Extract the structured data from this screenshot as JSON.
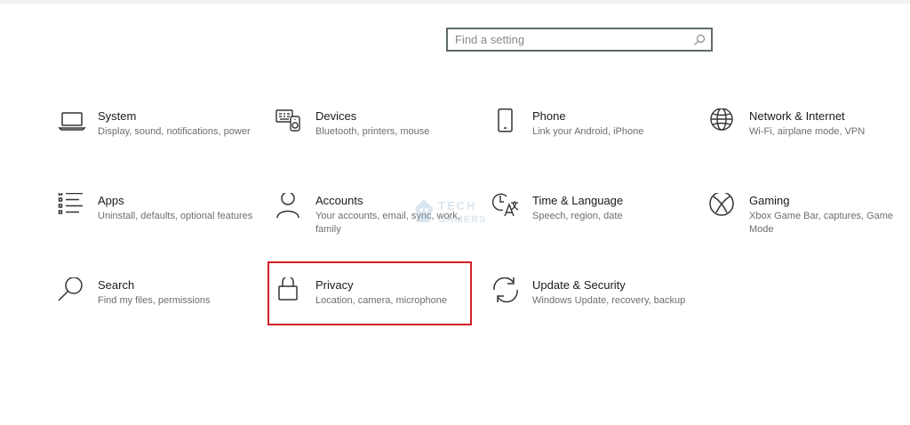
{
  "search": {
    "placeholder": "Find a setting",
    "value": ""
  },
  "tiles": [
    {
      "name": "System",
      "desc": "Display, sound, notifications, power",
      "icon": "laptop-icon"
    },
    {
      "name": "Devices",
      "desc": "Bluetooth, printers, mouse",
      "icon": "devices-icon"
    },
    {
      "name": "Phone",
      "desc": "Link your Android, iPhone",
      "icon": "phone-icon"
    },
    {
      "name": "Network & Internet",
      "desc": "Wi-Fi, airplane mode, VPN",
      "icon": "globe-icon"
    },
    {
      "name": "Apps",
      "desc": "Uninstall, defaults, optional features",
      "icon": "apps-list-icon"
    },
    {
      "name": "Accounts",
      "desc": "Your accounts, email, sync, work, family",
      "icon": "person-icon"
    },
    {
      "name": "Time & Language",
      "desc": "Speech, region, date",
      "icon": "time-language-icon"
    },
    {
      "name": "Gaming",
      "desc": "Xbox Game Bar, captures, Game Mode",
      "icon": "xbox-icon"
    },
    {
      "name": "Search",
      "desc": "Find my files, permissions",
      "icon": "search-icon"
    },
    {
      "name": "Privacy",
      "desc": "Location, camera, microphone",
      "icon": "lock-icon"
    },
    {
      "name": "Update & Security",
      "desc": "Windows Update, recovery, backup",
      "icon": "update-icon"
    }
  ],
  "highlight": {
    "color": "#d42027",
    "target": "Privacy"
  },
  "watermark": {
    "line1": "TECH",
    "line2": "GAMERS"
  }
}
